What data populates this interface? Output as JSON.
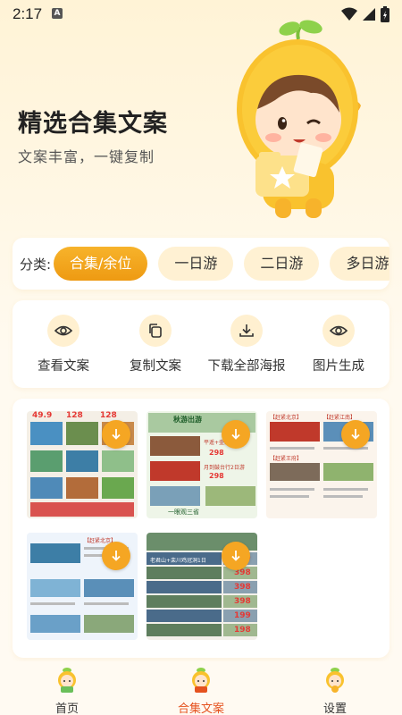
{
  "status": {
    "time": "2:17",
    "notif_letter": "A"
  },
  "hero": {
    "title": "精选合集文案",
    "subtitle": "文案丰富，一键复制"
  },
  "category": {
    "label": "分类:",
    "chips": [
      "合集/余位",
      "一日游",
      "二日游",
      "多日游"
    ],
    "active_index": 0
  },
  "actions": [
    {
      "label": "查看文案",
      "icon": "eye-icon"
    },
    {
      "label": "复制文案",
      "icon": "copy-icon"
    },
    {
      "label": "下载全部海报",
      "icon": "download-icon"
    },
    {
      "label": "图片生成",
      "icon": "eye-icon"
    }
  ],
  "gallery": {
    "items": [
      {
        "name": "poster-1",
        "texts": [
          "49.9",
          "128",
          "128"
        ]
      },
      {
        "name": "poster-2",
        "texts": [
          "秋游出游",
          "平遥+壶口+太原",
          "298",
          "月到鼓台行2日游",
          "298",
          "一眼观三省"
        ]
      },
      {
        "name": "poster-3",
        "texts": [
          "【赶紧北京】",
          "【赶紧江南】",
          "【赶紧王府】"
        ]
      },
      {
        "name": "poster-4",
        "texts": [
          "【赶紧北京】"
        ]
      },
      {
        "name": "poster-5",
        "texts": [
          "老君山+栾川鸡冠洞1日",
          "299",
          "398",
          "398",
          "398",
          "199",
          "198"
        ]
      }
    ]
  },
  "nav": {
    "items": [
      {
        "label": "首页",
        "icon": "home-mascot-icon"
      },
      {
        "label": "合集文案",
        "icon": "collection-mascot-icon"
      },
      {
        "label": "设置",
        "icon": "settings-mascot-icon"
      }
    ],
    "active_index": 1
  },
  "colors": {
    "accent": "#f5a623",
    "nav_active": "#e5521f",
    "chip_bg": "#fff1d3"
  }
}
